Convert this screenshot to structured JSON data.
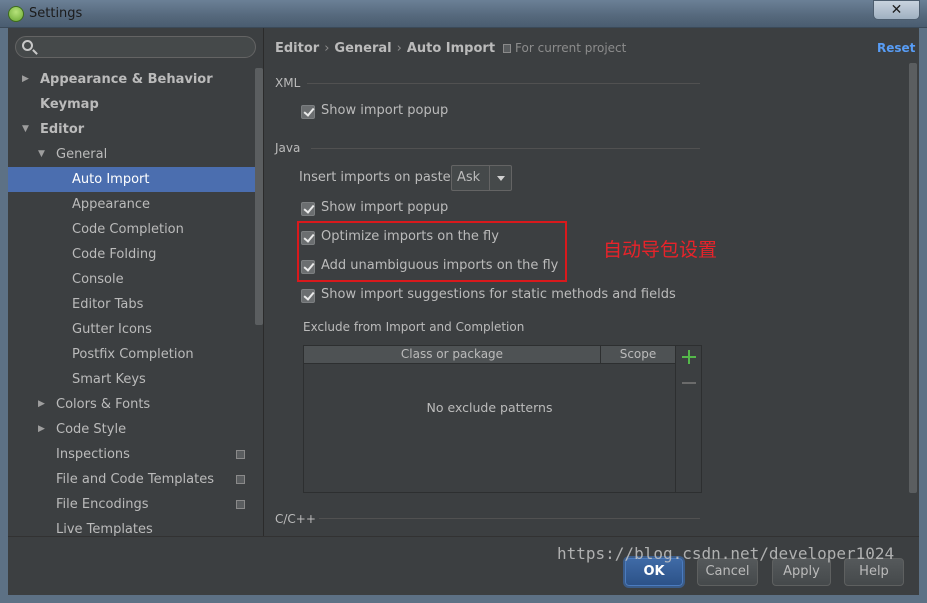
{
  "window": {
    "title": "Settings",
    "close_glyph": "✕"
  },
  "sidebar": {
    "search": {
      "placeholder": "",
      "value": ""
    },
    "items": [
      {
        "label": "Appearance & Behavior",
        "level": 0,
        "arrow": "▶",
        "bold": true
      },
      {
        "label": "Keymap",
        "level": 0,
        "arrow": "",
        "bold": true
      },
      {
        "label": "Editor",
        "level": 0,
        "arrow": "▼",
        "bold": true
      },
      {
        "label": "General",
        "level": 1,
        "arrow": "▼"
      },
      {
        "label": "Auto Import",
        "level": 2,
        "arrow": "",
        "selected": true
      },
      {
        "label": "Appearance",
        "level": 2,
        "arrow": ""
      },
      {
        "label": "Code Completion",
        "level": 2,
        "arrow": ""
      },
      {
        "label": "Code Folding",
        "level": 2,
        "arrow": ""
      },
      {
        "label": "Console",
        "level": 2,
        "arrow": ""
      },
      {
        "label": "Editor Tabs",
        "level": 2,
        "arrow": ""
      },
      {
        "label": "Gutter Icons",
        "level": 2,
        "arrow": ""
      },
      {
        "label": "Postfix Completion",
        "level": 2,
        "arrow": ""
      },
      {
        "label": "Smart Keys",
        "level": 2,
        "arrow": ""
      },
      {
        "label": "Colors & Fonts",
        "level": 1,
        "arrow": "▶"
      },
      {
        "label": "Code Style",
        "level": 1,
        "arrow": "▶"
      },
      {
        "label": "Inspections",
        "level": 1,
        "arrow": "",
        "project": true
      },
      {
        "label": "File and Code Templates",
        "level": 1,
        "arrow": "",
        "project": true
      },
      {
        "label": "File Encodings",
        "level": 1,
        "arrow": "",
        "project": true
      },
      {
        "label": "Live Templates",
        "level": 1,
        "arrow": ""
      }
    ]
  },
  "header": {
    "breadcrumb": [
      "Editor",
      "General",
      "Auto Import"
    ],
    "separator": "›",
    "scope_note": "For current project",
    "reset_label": "Reset"
  },
  "xml": {
    "title": "XML",
    "show_import_popup": {
      "label": "Show import popup",
      "checked": true
    }
  },
  "java": {
    "title": "Java",
    "insert_imports_label": "Insert imports on paste:",
    "insert_imports_value": "Ask",
    "show_import_popup": {
      "label": "Show import popup",
      "checked": true
    },
    "optimize_imports": {
      "label": "Optimize imports on the fly",
      "checked": true
    },
    "add_unambiguous": {
      "label": "Add unambiguous imports on the fly",
      "checked": true
    },
    "show_suggestions": {
      "label": "Show import suggestions for static methods and fields",
      "checked": true
    }
  },
  "annotation": {
    "text": "自动导包设置",
    "color": "#e8232a"
  },
  "exclude": {
    "title": "Exclude from Import and Completion",
    "columns": [
      "Class or package",
      "Scope"
    ],
    "empty_text": "No exclude patterns"
  },
  "cpp": {
    "title": "C/C++"
  },
  "buttons": {
    "ok": "OK",
    "cancel": "Cancel",
    "apply": "Apply",
    "help": "Help"
  },
  "watermark": "https://blog.csdn.net/developer1024",
  "colors": {
    "accent": "#4b6eaf",
    "link": "#589df6",
    "background": "#3c3f41",
    "highlight_box": "#d9191c"
  }
}
